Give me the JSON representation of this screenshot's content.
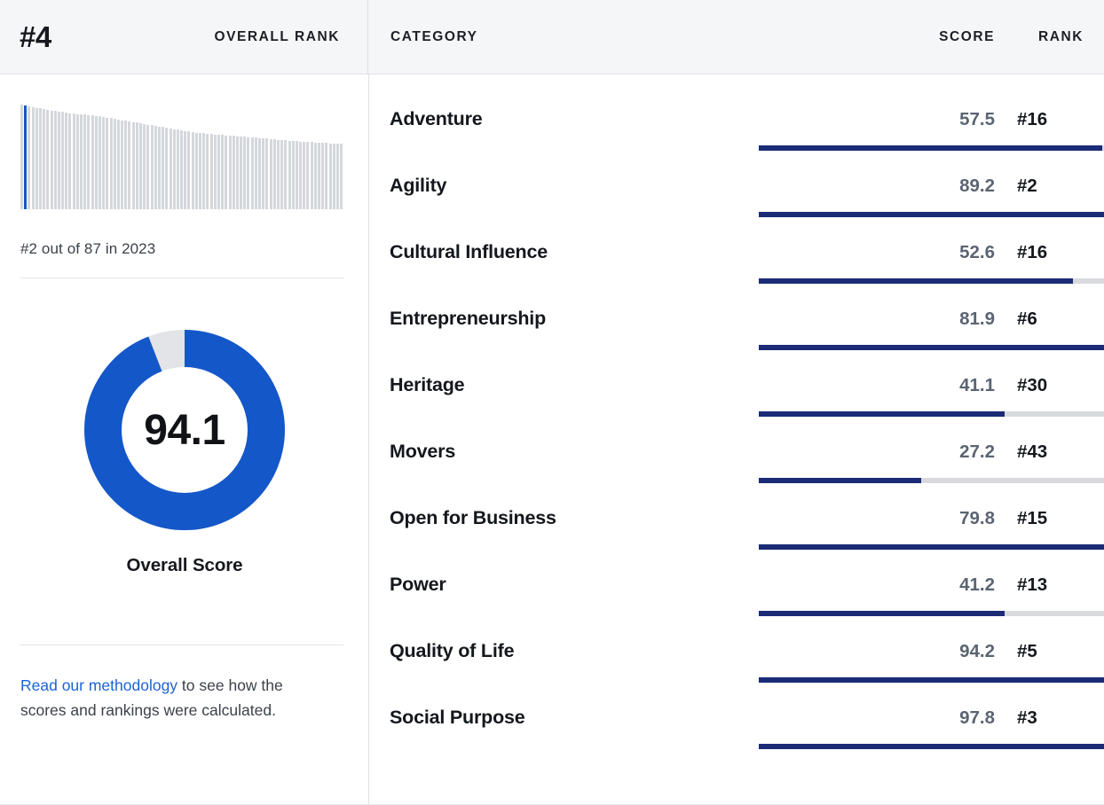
{
  "header": {
    "overall_rank": "#4",
    "overall_rank_label": "OVERALL RANK",
    "category_label": "CATEGORY",
    "score_label": "SCORE",
    "rank_label": "RANK"
  },
  "left_panel": {
    "spark_caption": "#2 out of 87 in 2023",
    "overall_score": "94.1",
    "overall_score_label": "Overall Score",
    "methodology_link": "Read our methodology",
    "methodology_rest": " to see how the scores and rankings were calculated."
  },
  "colors": {
    "accent_blue": "#1457c9",
    "bar_navy": "#1b2b75",
    "track_gray": "#d8dade",
    "header_bg": "#f5f6f8",
    "link_blue": "#1a64d4",
    "score_gray": "#5a6472"
  },
  "chart_data": [
    {
      "type": "bar",
      "title": "Overall score distribution sparkline",
      "xlabel": "",
      "ylabel": "",
      "ylim": [
        0,
        100
      ],
      "grid": false,
      "highlight_index": 1,
      "highlight_label": "#2 out of 87 in 2023",
      "categories": [
        "1",
        "2",
        "3",
        "4",
        "5",
        "6",
        "7",
        "8",
        "9",
        "10",
        "11",
        "12",
        "13",
        "14",
        "15",
        "16",
        "17",
        "18",
        "19",
        "20",
        "21",
        "22",
        "23",
        "24",
        "25",
        "26",
        "27",
        "28",
        "29",
        "30",
        "31",
        "32",
        "33",
        "34",
        "35",
        "36",
        "37",
        "38",
        "39",
        "40",
        "41",
        "42",
        "43",
        "44",
        "45",
        "46",
        "47",
        "48",
        "49",
        "50",
        "51",
        "52",
        "53",
        "54",
        "55",
        "56",
        "57",
        "58",
        "59",
        "60",
        "61",
        "62",
        "63",
        "64",
        "65",
        "66",
        "67",
        "68",
        "69",
        "70",
        "71",
        "72",
        "73",
        "74",
        "75",
        "76",
        "77",
        "78",
        "79",
        "80",
        "81",
        "82",
        "83",
        "84",
        "85",
        "86",
        "87"
      ],
      "values": [
        100,
        99.4,
        98.5,
        97.7,
        97.0,
        96.3,
        95.7,
        95.1,
        94.5,
        93.9,
        93.4,
        92.9,
        92.4,
        91.9,
        91.5,
        91.1,
        90.7,
        90.3,
        89.9,
        89.5,
        89.1,
        88.6,
        88.1,
        87.5,
        86.9,
        86.3,
        85.7,
        85.1,
        84.5,
        83.9,
        83.3,
        82.7,
        82.1,
        81.5,
        80.9,
        80.3,
        79.7,
        79.1,
        78.5,
        77.9,
        77.3,
        76.7,
        76.1,
        75.5,
        74.9,
        74.3,
        73.7,
        73.2,
        72.8,
        72.5,
        72.2,
        71.9,
        71.6,
        71.3,
        71.0,
        70.7,
        70.4,
        70.1,
        69.8,
        69.5,
        69.2,
        68.9,
        68.6,
        68.3,
        68.0,
        67.7,
        67.4,
        67.1,
        66.8,
        66.5,
        66.2,
        65.9,
        65.6,
        65.3,
        65.0,
        64.7,
        64.4,
        64.2,
        64.0,
        63.8,
        63.6,
        63.4,
        63.2,
        63.0,
        62.8,
        62.6,
        62.4
      ]
    },
    {
      "type": "pie",
      "title": "Overall Score",
      "legend": "none",
      "labels": [
        "Score",
        "Remainder"
      ],
      "values": [
        94.1,
        5.9
      ],
      "value_text": "94.1",
      "colors": [
        "#1457c9",
        "#e2e4e8"
      ]
    },
    {
      "type": "bar",
      "title": "Category scores and ranks",
      "xlabel": "Score",
      "ylabel": "Category",
      "xlim": [
        0,
        100
      ],
      "grid": false,
      "orientation": "horizontal",
      "categories": [
        "Adventure",
        "Agility",
        "Cultural Influence",
        "Entrepreneurship",
        "Heritage",
        "Movers",
        "Open for Business",
        "Power",
        "Quality of Life",
        "Social Purpose"
      ],
      "values": [
        57.5,
        89.2,
        52.6,
        81.9,
        41.1,
        27.2,
        79.8,
        41.2,
        94.2,
        97.8
      ],
      "ranks": [
        "#16",
        "#2",
        "#16",
        "#6",
        "#30",
        "#43",
        "#15",
        "#13",
        "#5",
        "#3"
      ]
    }
  ],
  "categories": [
    {
      "name": "Adventure",
      "score": "57.5",
      "value": 57.5,
      "rank": "#16"
    },
    {
      "name": "Agility",
      "score": "89.2",
      "value": 89.2,
      "rank": "#2"
    },
    {
      "name": "Cultural Influence",
      "score": "52.6",
      "value": 52.6,
      "rank": "#16"
    },
    {
      "name": "Entrepreneurship",
      "score": "81.9",
      "value": 81.9,
      "rank": "#6"
    },
    {
      "name": "Heritage",
      "score": "41.1",
      "value": 41.1,
      "rank": "#30"
    },
    {
      "name": "Movers",
      "score": "27.2",
      "value": 27.2,
      "rank": "#43"
    },
    {
      "name": "Open for Business",
      "score": "79.8",
      "value": 79.8,
      "rank": "#15"
    },
    {
      "name": "Power",
      "score": "41.2",
      "value": 41.2,
      "rank": "#13"
    },
    {
      "name": "Quality of Life",
      "score": "94.2",
      "value": 94.2,
      "rank": "#5"
    },
    {
      "name": "Social Purpose",
      "score": "97.8",
      "value": 97.8,
      "rank": "#3"
    }
  ]
}
